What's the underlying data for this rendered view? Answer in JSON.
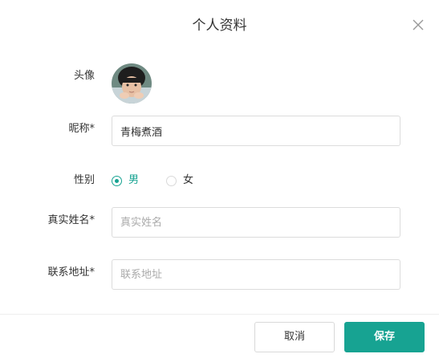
{
  "dialog": {
    "title": "个人资料",
    "close_icon": "close-icon"
  },
  "form": {
    "avatar": {
      "label": "头像"
    },
    "nickname": {
      "label": "昵称*",
      "value": "青梅煮酒"
    },
    "gender": {
      "label": "性别",
      "options": [
        {
          "label": "男",
          "checked": true
        },
        {
          "label": "女",
          "checked": false
        }
      ]
    },
    "real_name": {
      "label": "真实姓名*",
      "value": "",
      "placeholder": "真实姓名"
    },
    "address": {
      "label": "联系地址*",
      "value": "",
      "placeholder": "联系地址"
    }
  },
  "footer": {
    "cancel_label": "取消",
    "save_label": "保存"
  },
  "colors": {
    "accent": "#17a392",
    "border": "#dcdcdc",
    "text": "#333333",
    "placeholder": "#aaaaaa"
  }
}
